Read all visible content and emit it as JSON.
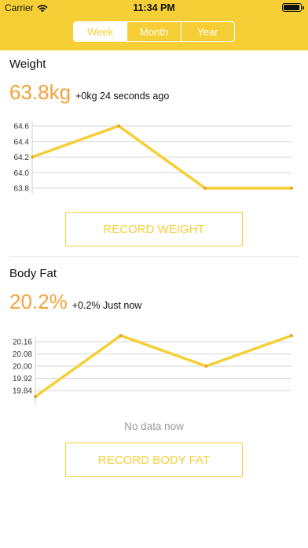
{
  "status_bar": {
    "carrier": "Carrier",
    "time": "11:34 PM",
    "battery_level": 0.95
  },
  "tabs": [
    {
      "label": "Week",
      "active": true
    },
    {
      "label": "Month",
      "active": false
    },
    {
      "label": "Year",
      "active": false
    }
  ],
  "colors": {
    "accent": "#f6cf36",
    "value_orange": "#f2a33a"
  },
  "weight": {
    "title": "Weight",
    "value": "63.8kg",
    "delta_text": "+0kg 24 seconds ago",
    "button_label": "RECORD WEIGHT"
  },
  "body_fat": {
    "title": "Body Fat",
    "value": "20.2%",
    "delta_text": "+0.2% Just now",
    "no_data_text": "No data now",
    "button_label": "RECORD BODY FAT"
  },
  "chart_data": [
    {
      "type": "line",
      "ylim": [
        63.8,
        64.6
      ],
      "yticks": [
        "64.6",
        "64.4",
        "64.2",
        "64.0",
        "63.8"
      ],
      "x": [
        0,
        1,
        2,
        3
      ],
      "values": [
        64.2,
        64.6,
        63.8,
        63.8
      ],
      "grid": true
    },
    {
      "type": "line",
      "ylim": [
        19.8,
        20.2
      ],
      "yticks": [
        "20.16",
        "20.08",
        "20.00",
        "19.92",
        "19.84"
      ],
      "x": [
        0,
        1,
        2,
        3
      ],
      "values": [
        19.8,
        20.2,
        20.0,
        20.2
      ],
      "grid": true
    }
  ]
}
